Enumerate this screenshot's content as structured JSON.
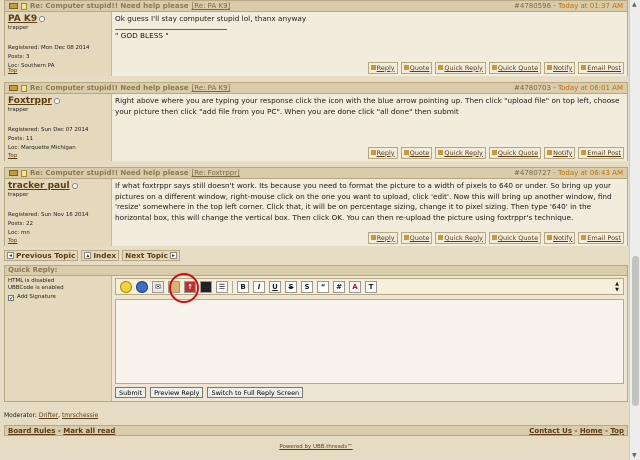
{
  "posts": [
    {
      "subject": "Re: Computer stupid!! Need help please",
      "reply_to": "[Re: PA K9]",
      "post_id": "#4780596",
      "time": "Today at 01:37 AM",
      "author": "PA K9",
      "author_title": "trapper",
      "registered": "Registered: Mon Dec 08 2014",
      "posts": "Posts: 3",
      "loc": "Loc: Southern PA",
      "body": "Ok guess I'll stay computer stupid lol, thanx anyway",
      "signature": "\" GOD BLESS \""
    },
    {
      "subject": "Re: Computer stupid!! Need help please",
      "reply_to": "[Re: PA K9]",
      "post_id": "#4780703",
      "time": "Today at 06:01 AM",
      "author": "Foxtrppr",
      "author_title": "trapper",
      "registered": "Registered: Sun Dec 07 2014",
      "posts": "Posts: 11",
      "loc": "Loc: Marquette Michigan",
      "body": "Right above where you are typing your response click the icon with the blue arrow pointing up. Then click \"upload file\" on top left, choose your picture then click \"add file from you PC\". When you are done click \"all done\" then submit",
      "signature": ""
    },
    {
      "subject": "Re: Computer stupid!! Need help please",
      "reply_to": "[Re: Foxtrppr]",
      "post_id": "#4780727",
      "time": "Today at 06:43 AM",
      "author": "tracker paul",
      "author_title": "trapper",
      "registered": "Registered: Sun Nov 16 2014",
      "posts": "Posts: 22",
      "loc": "Loc: mn",
      "body": "If what foxtrppr says still doesn't work. Its because you need to format the picture to a width of pixels to 640 or under. So bring up your pictures on a different window, right-mouse click on the one you want to upload, click 'edit'. Now this will bring up another window, find 'resize' somewhere in the top left corner. Click that, it will be on percentage sizing, change it to pixel sizing. Then type '640' in the horizontal box, this will change the vertical box. Then click OK. You can then re-upload the picture using foxtrppr's technique.",
      "signature": ""
    }
  ],
  "post_actions": [
    "Reply",
    "Quote",
    "Quick Reply",
    "Quick Quote",
    "Notify",
    "Email Post"
  ],
  "top_label": "Top",
  "nav": {
    "previous": "Previous Topic",
    "index": "Index",
    "next": "Next Topic"
  },
  "quick_reply": {
    "header": "Quick Reply:",
    "html_status": "HTML is disabled",
    "ubbcode_status": "UBBCode is enabled",
    "add_signature": "Add Signature",
    "toolbar": [
      "B",
      "I",
      "U",
      "S",
      "S",
      "“",
      "#",
      "A",
      "T"
    ],
    "submit": "Submit",
    "preview": "Preview Reply",
    "full_reply": "Switch to Full Reply Screen",
    "message_value": ""
  },
  "moderator": {
    "label": "Moderator:",
    "names": [
      "Drifter",
      "tmrschessie"
    ]
  },
  "footer": {
    "board_rules": "Board Rules",
    "mark_all_read": "Mark all read",
    "contact_us": "Contact Us",
    "home": "Home",
    "top": "Top",
    "powered": "Powered by UBB.threads™"
  }
}
